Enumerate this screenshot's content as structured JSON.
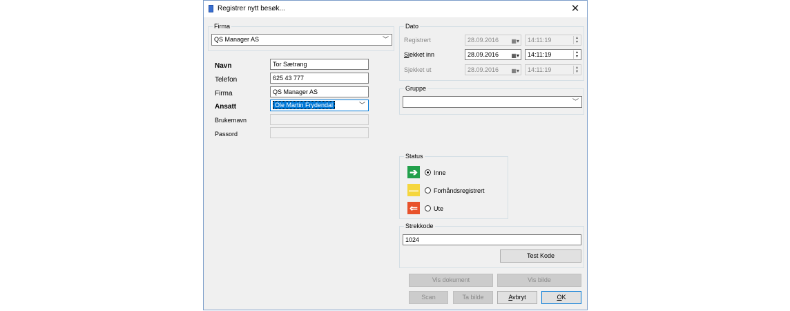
{
  "window": {
    "title": "Registrer nytt besøk...",
    "close_glyph": "✕"
  },
  "firma_group": {
    "title": "Firma",
    "selected": "QS Manager AS"
  },
  "person": {
    "navn_label": "Navn",
    "navn_value": "Tor Sætrang",
    "telefon_label": "Telefon",
    "telefon_value": "625 43 777",
    "firma_label": "Firma",
    "firma_value": "QS Manager AS",
    "ansatt_label": "Ansatt",
    "ansatt_value": "Ole Martin Frydendal",
    "brukernavn_label": "Brukernavn",
    "brukernavn_value": "",
    "passord_label": "Passord",
    "passord_value": ""
  },
  "dato": {
    "title": "Dato",
    "registrert": {
      "label": "Registrert",
      "date": "28.09.2016",
      "time": "14:11:19"
    },
    "sjekket_inn": {
      "label": "Sjekket inn",
      "date": "28.09.2016",
      "time": "14:11:19"
    },
    "sjekket_ut": {
      "label": "Sjekket ut",
      "date": "28.09.2016",
      "time": "14:11:19"
    }
  },
  "gruppe": {
    "title": "Gruppe",
    "selected": ""
  },
  "status": {
    "title": "Status",
    "options": [
      {
        "label": "Inne",
        "glyph": "➔",
        "color": "#22a04b",
        "selected": true
      },
      {
        "label": "Forhåndsregistrert",
        "glyph": "—",
        "color": "#f5d63d",
        "selected": false
      },
      {
        "label": "Ute",
        "glyph": "⇐",
        "color": "#e8522b",
        "selected": false
      }
    ]
  },
  "strekkode": {
    "title": "Strekkode",
    "value": "1024",
    "test_button": "Test Kode"
  },
  "buttons": {
    "vis_dokument": "Vis dokument",
    "vis_bilde": "Vis bilde",
    "scan": "Scan",
    "ta_bilde": "Ta bilde",
    "avbryt_accel": "A",
    "avbryt_rest": "vbryt",
    "ok_accel": "O",
    "ok_rest": "K"
  },
  "colors": {
    "accent": "#0078d7",
    "window_border": "#7a9cc9"
  }
}
